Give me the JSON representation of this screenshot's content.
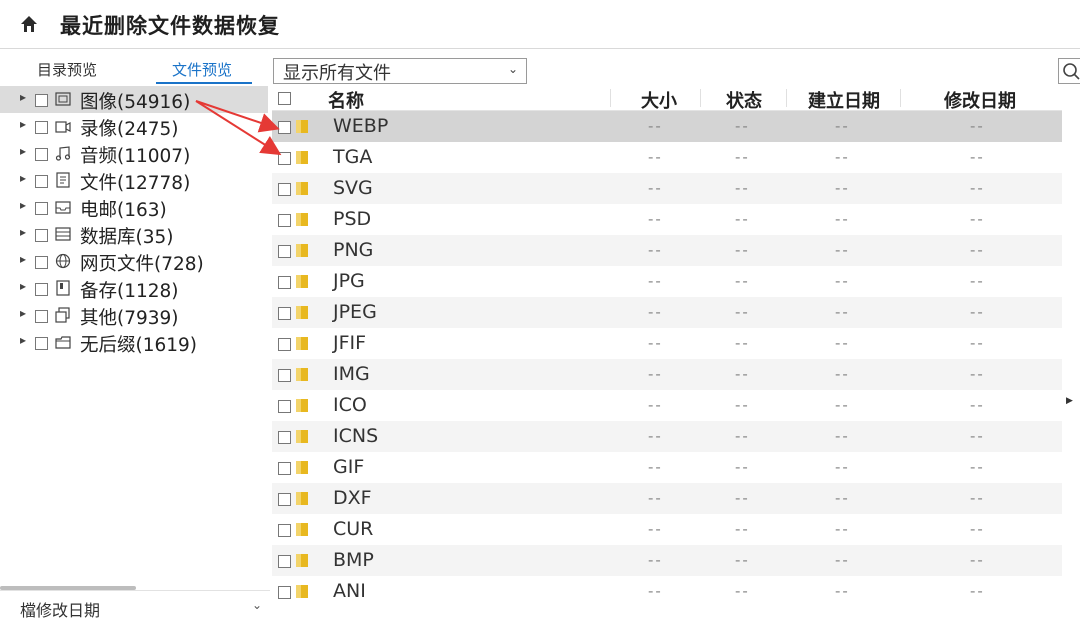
{
  "header": {
    "title": "最近删除文件数据恢复"
  },
  "left_panel": {
    "tabs": [
      "目录预览",
      "文件预览"
    ],
    "tree": [
      {
        "label": "图像(54916)",
        "icon": "image-icon",
        "selected": true
      },
      {
        "label": "录像(2475)",
        "icon": "video-icon"
      },
      {
        "label": "音频(11007)",
        "icon": "music-icon"
      },
      {
        "label": "文件(12778)",
        "icon": "document-icon"
      },
      {
        "label": "电邮(163)",
        "icon": "mail-icon"
      },
      {
        "label": "数据库(35)",
        "icon": "database-icon"
      },
      {
        "label": "网页文件(728)",
        "icon": "globe-icon"
      },
      {
        "label": "备存(1128)",
        "icon": "backup-icon"
      },
      {
        "label": "其他(7939)",
        "icon": "other-icon"
      },
      {
        "label": "无后缀(1619)",
        "icon": "no-suffix-icon"
      }
    ],
    "sort_label": "檔修改日期"
  },
  "filter": {
    "selected": "显示所有文件"
  },
  "table": {
    "columns": [
      "名称",
      "大小",
      "状态",
      "建立日期",
      "修改日期"
    ],
    "rows": [
      {
        "name": "WEBP",
        "size": "--",
        "status": "--",
        "created": "--",
        "modified": "--"
      },
      {
        "name": "TGA",
        "size": "--",
        "status": "--",
        "created": "--",
        "modified": "--"
      },
      {
        "name": "SVG",
        "size": "--",
        "status": "--",
        "created": "--",
        "modified": "--"
      },
      {
        "name": "PSD",
        "size": "--",
        "status": "--",
        "created": "--",
        "modified": "--"
      },
      {
        "name": "PNG",
        "size": "--",
        "status": "--",
        "created": "--",
        "modified": "--"
      },
      {
        "name": "JPG",
        "size": "--",
        "status": "--",
        "created": "--",
        "modified": "--"
      },
      {
        "name": "JPEG",
        "size": "--",
        "status": "--",
        "created": "--",
        "modified": "--"
      },
      {
        "name": "JFIF",
        "size": "--",
        "status": "--",
        "created": "--",
        "modified": "--"
      },
      {
        "name": "IMG",
        "size": "--",
        "status": "--",
        "created": "--",
        "modified": "--"
      },
      {
        "name": "ICO",
        "size": "--",
        "status": "--",
        "created": "--",
        "modified": "--"
      },
      {
        "name": "ICNS",
        "size": "--",
        "status": "--",
        "created": "--",
        "modified": "--"
      },
      {
        "name": "GIF",
        "size": "--",
        "status": "--",
        "created": "--",
        "modified": "--"
      },
      {
        "name": "DXF",
        "size": "--",
        "status": "--",
        "created": "--",
        "modified": "--"
      },
      {
        "name": "CUR",
        "size": "--",
        "status": "--",
        "created": "--",
        "modified": "--"
      },
      {
        "name": "BMP",
        "size": "--",
        "status": "--",
        "created": "--",
        "modified": "--"
      },
      {
        "name": "ANI",
        "size": "--",
        "status": "--",
        "created": "--",
        "modified": "--"
      }
    ]
  },
  "colors": {
    "accent": "#1a73c8",
    "annotation": "#e53935",
    "folder": "#e8b820",
    "selected_row": "#d4d4d4"
  }
}
